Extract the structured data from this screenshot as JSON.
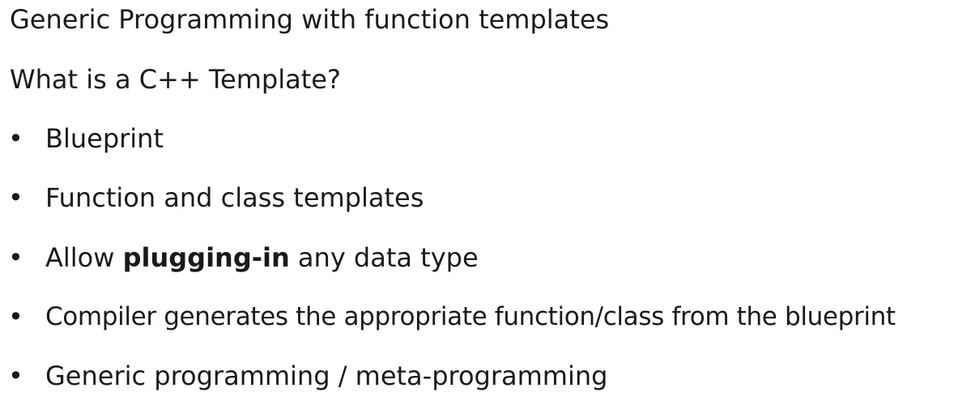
{
  "title": "Generic Programming with function templates",
  "question": "What is a C++ Template?",
  "bullet_glyph": "•",
  "bullets": [
    {
      "text": "Blueprint"
    },
    {
      "text": "Function and class templates"
    },
    {
      "prefix": "Allow ",
      "bold": "plugging-in",
      "suffix": " any data type"
    },
    {
      "text": "Compiler generates the appropriate function/class from the blueprint"
    },
    {
      "text": "Generic programming / meta-programming"
    }
  ]
}
